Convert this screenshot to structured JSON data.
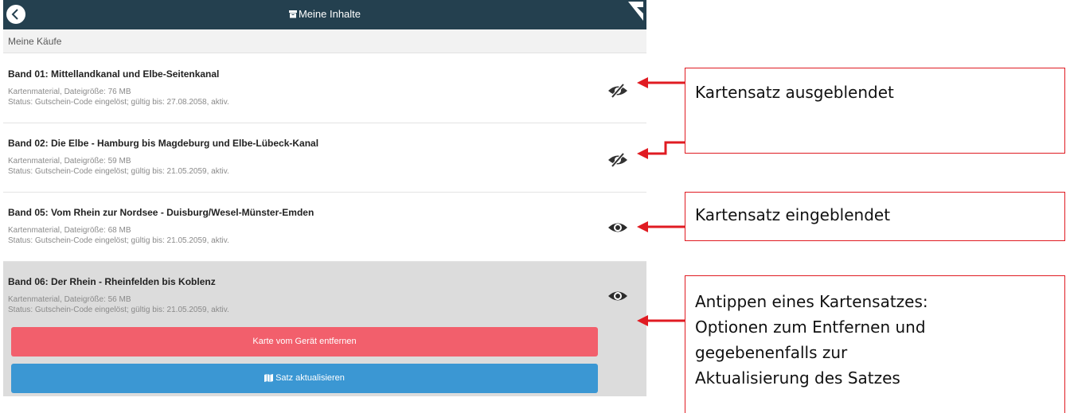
{
  "header": {
    "title": "Meine Inhalte",
    "back_icon": "back-arrow-icon",
    "title_icon": "box-icon",
    "corner_icon": "corner-fold-icon",
    "color": "#24404f"
  },
  "section": {
    "title": "Meine Käufe"
  },
  "items": [
    {
      "title": "Band 01: Mittellandkanal und Elbe-Seitenkanal",
      "details": "Kartenmaterial, Dateigröße: 76 MB",
      "status": "Status: Gutschein-Code eingelöst; gültig bis: 27.08.2058, aktiv.",
      "visibility_icon": "eye-slash-icon",
      "visible": false
    },
    {
      "title": "Band 02: Die Elbe - Hamburg bis Magdeburg und Elbe-Lübeck-Kanal",
      "details": "Kartenmaterial, Dateigröße: 59 MB",
      "status": "Status: Gutschein-Code eingelöst; gültig bis: 21.05.2059, aktiv.",
      "visibility_icon": "eye-slash-icon",
      "visible": false
    },
    {
      "title": "Band 05: Vom Rhein zur Nordsee - Duisburg/Wesel-Münster-Emden",
      "details": "Kartenmaterial, Dateigröße: 68 MB",
      "status": "Status: Gutschein-Code eingelöst; gültig bis: 21.05.2059, aktiv.",
      "visibility_icon": "eye-icon",
      "visible": true
    },
    {
      "title": "Band 06: Der Rhein - Rheinfelden bis Koblenz",
      "details": "Kartenmaterial, Dateigröße: 56 MB",
      "status": "Status: Gutschein-Code eingelöst; gültig bis: 21.05.2059, aktiv.",
      "visibility_icon": "eye-icon",
      "visible": true,
      "selected": true
    }
  ],
  "actions": {
    "remove_label": "Karte vom Gerät entfernen",
    "update_label": "Satz aktualisieren",
    "update_icon": "map-icon",
    "remove_color": "#f25f6c",
    "update_color": "#3b97d3"
  },
  "annotations": {
    "hidden_label": "Kartensatz ausgeblendet",
    "visible_label": "Kartensatz eingeblendet",
    "tap_label_lines": [
      "Antippen eines Kartensatzes:",
      "Optionen zum Entfernen und",
      "gegebenenfalls zur",
      "Aktualisierung des Satzes"
    ],
    "accent_color": "#e01b22"
  }
}
